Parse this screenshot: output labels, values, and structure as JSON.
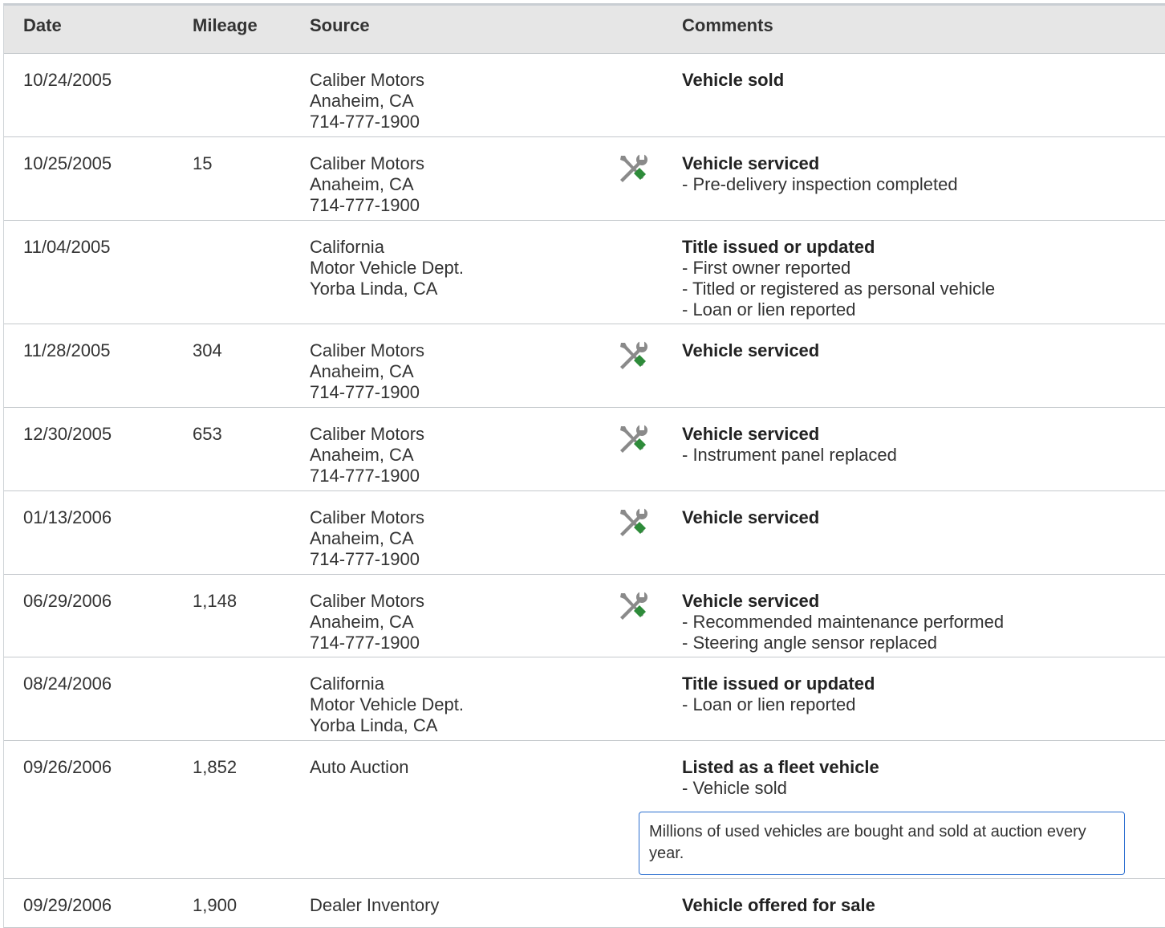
{
  "headers": {
    "date": "Date",
    "mileage": "Mileage",
    "source": "Source",
    "comments": "Comments"
  },
  "icons": {
    "service": "wrench-screwdriver-icon"
  },
  "colors": {
    "icon_gray": "#8a8a8a",
    "icon_green": "#2e8b3a",
    "note_border": "#2c6fd0"
  },
  "rows": [
    {
      "date": "10/24/2005",
      "mileage": "",
      "source": [
        "Caliber Motors",
        "Anaheim, CA",
        "714-777-1900"
      ],
      "service": false,
      "title": "Vehicle sold",
      "items": [],
      "note": ""
    },
    {
      "date": "10/25/2005",
      "mileage": "15",
      "source": [
        "Caliber Motors",
        "Anaheim, CA",
        "714-777-1900"
      ],
      "service": true,
      "title": "Vehicle serviced",
      "items": [
        "- Pre-delivery inspection completed"
      ],
      "note": ""
    },
    {
      "date": "11/04/2005",
      "mileage": "",
      "source": [
        "California",
        "Motor Vehicle Dept.",
        "Yorba Linda, CA"
      ],
      "service": false,
      "title": "Title issued or updated",
      "items": [
        "- First owner reported",
        "- Titled or registered as personal vehicle",
        "- Loan or lien reported"
      ],
      "note": ""
    },
    {
      "date": "11/28/2005",
      "mileage": "304",
      "source": [
        "Caliber Motors",
        "Anaheim, CA",
        "714-777-1900"
      ],
      "service": true,
      "title": "Vehicle serviced",
      "items": [],
      "note": ""
    },
    {
      "date": "12/30/2005",
      "mileage": "653",
      "source": [
        "Caliber Motors",
        "Anaheim, CA",
        "714-777-1900"
      ],
      "service": true,
      "title": "Vehicle serviced",
      "items": [
        "- Instrument panel replaced"
      ],
      "note": ""
    },
    {
      "date": "01/13/2006",
      "mileage": "",
      "source": [
        "Caliber Motors",
        "Anaheim, CA",
        "714-777-1900"
      ],
      "service": true,
      "title": "Vehicle serviced",
      "items": [],
      "note": ""
    },
    {
      "date": "06/29/2006",
      "mileage": "1,148",
      "source": [
        "Caliber Motors",
        "Anaheim, CA",
        "714-777-1900"
      ],
      "service": true,
      "title": "Vehicle serviced",
      "items": [
        "- Recommended maintenance performed",
        "- Steering angle sensor replaced"
      ],
      "note": ""
    },
    {
      "date": "08/24/2006",
      "mileage": "",
      "source": [
        "California",
        "Motor Vehicle Dept.",
        "Yorba Linda, CA"
      ],
      "service": false,
      "title": "Title issued or updated",
      "items": [
        "- Loan or lien reported"
      ],
      "note": ""
    },
    {
      "date": "09/26/2006",
      "mileage": "1,852",
      "source": [
        "Auto Auction"
      ],
      "service": false,
      "title": "Listed as a fleet vehicle",
      "items": [
        "- Vehicle sold"
      ],
      "note": "Millions of used vehicles are bought and sold at auction every year."
    },
    {
      "date": "09/29/2006",
      "mileage": "1,900",
      "source": [
        "Dealer Inventory"
      ],
      "service": false,
      "title": "Vehicle offered for sale",
      "items": [],
      "note": ""
    }
  ]
}
